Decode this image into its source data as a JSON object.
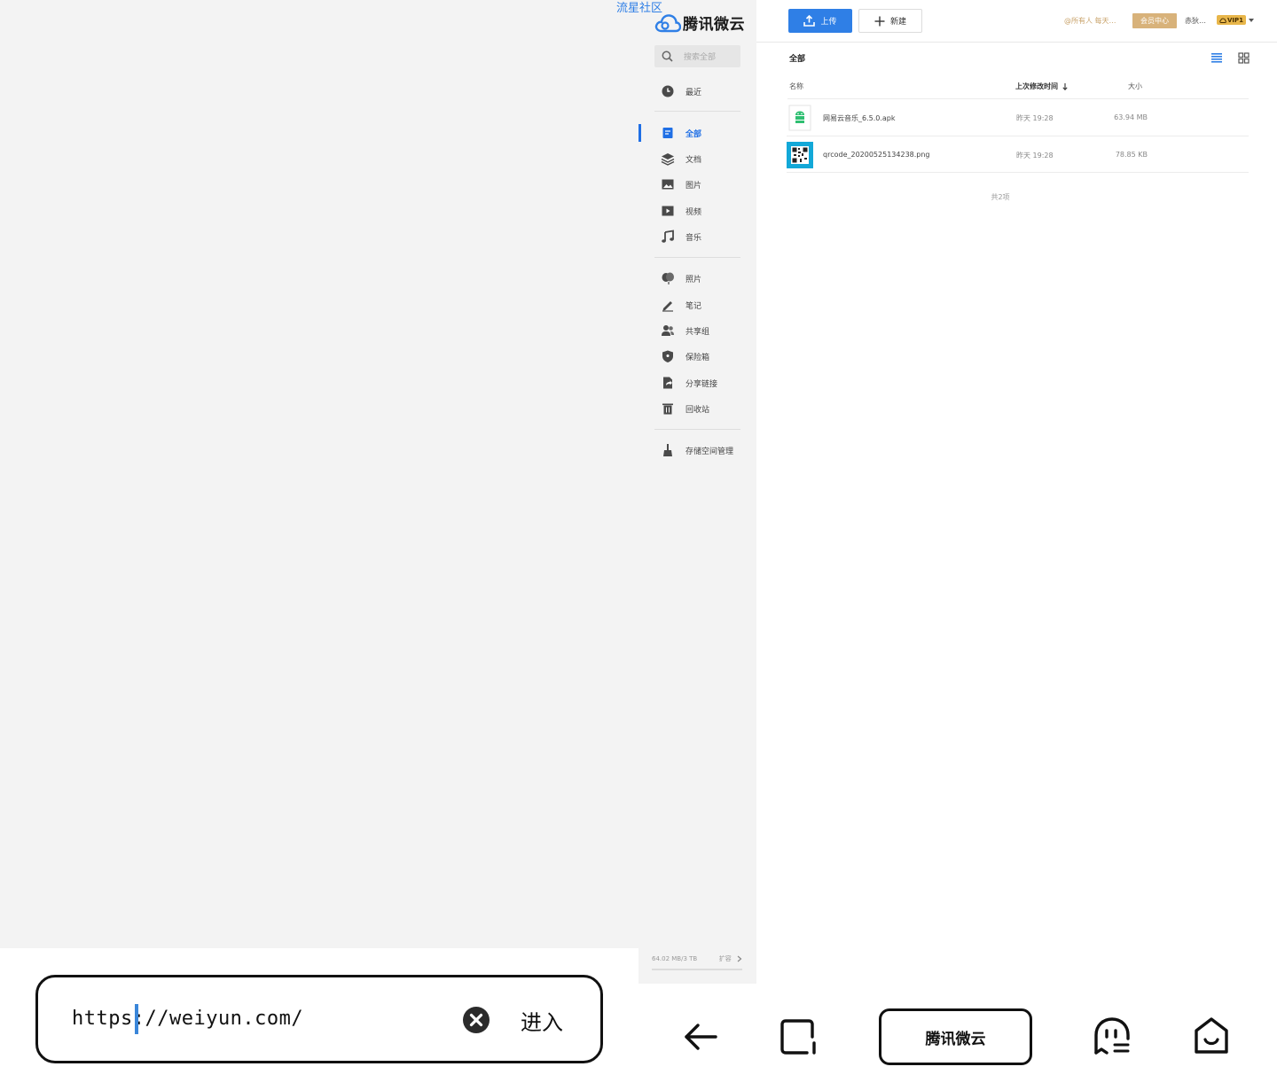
{
  "overlay": {
    "community": "流星社区"
  },
  "brand": {
    "name": "腾讯微云"
  },
  "sidebar": {
    "search_placeholder": "搜索全部",
    "items": [
      {
        "label": "最近",
        "icon": "clock-icon"
      },
      {
        "label": "全部",
        "icon": "document-icon",
        "active": true
      },
      {
        "label": "文档",
        "icon": "layers-icon"
      },
      {
        "label": "图片",
        "icon": "image-icon"
      },
      {
        "label": "视频",
        "icon": "video-icon"
      },
      {
        "label": "音乐",
        "icon": "music-icon"
      },
      {
        "label": "照片",
        "icon": "photo-balloon-icon"
      },
      {
        "label": "笔记",
        "icon": "pen-icon"
      },
      {
        "label": "共享组",
        "icon": "group-icon"
      },
      {
        "label": "保险箱",
        "icon": "shield-icon"
      },
      {
        "label": "分享链接",
        "icon": "share-link-icon"
      },
      {
        "label": "回收站",
        "icon": "trash-icon"
      },
      {
        "label": "存储空间管理",
        "icon": "broom-icon"
      }
    ],
    "storage": {
      "used": "64.02 MB/3 TB",
      "expand": "扩容"
    }
  },
  "toolbar": {
    "upload_label": "上传",
    "new_label": "新建",
    "notice": "@所有人 每天…",
    "member_center": "会员中心",
    "user_name": "赤狄…",
    "vip": "VIP1"
  },
  "main": {
    "crumb": "全部",
    "columns": {
      "name": "名称",
      "modified": "上次修改时间",
      "size": "大小"
    },
    "files": [
      {
        "name": "网易云音乐_6.5.0.apk",
        "modified": "昨天 19:28",
        "size": "63.94 MB",
        "type": "apk"
      },
      {
        "name": "qrcode_20200525134238.png",
        "modified": "昨天 19:28",
        "size": "78.85 KB",
        "type": "image"
      }
    ],
    "total": "共2项"
  },
  "urlbar": {
    "value": "https://weiyun.com/",
    "enter_label": "进入"
  },
  "bottom_nav": {
    "title": "腾讯微云"
  }
}
